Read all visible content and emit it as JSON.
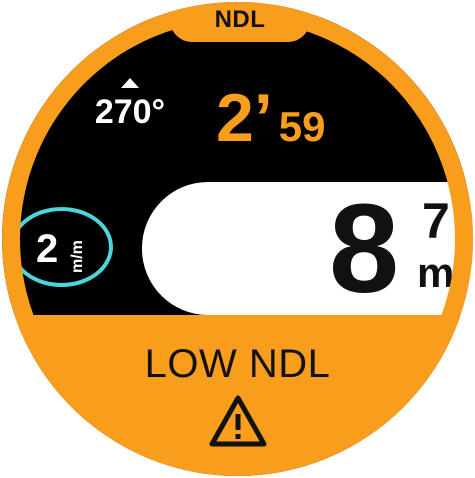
{
  "ndl_tab": {
    "label": "NDL"
  },
  "heading": {
    "value": "270°",
    "icon": "arrow-up-icon"
  },
  "ndl_time": {
    "minutes": "2’",
    "seconds": "59"
  },
  "depth": {
    "whole": "8",
    "decimal": "7",
    "unit": "m"
  },
  "ascent_rate": {
    "value": "2",
    "unit": "m/m"
  },
  "alert": {
    "text": "LOW NDL",
    "icon": "warning-triangle-icon"
  },
  "colors": {
    "accent": "#f99d1c",
    "rate_ring": "#4ad6dc",
    "background": "#000000",
    "depth_panel": "#ffffff"
  }
}
